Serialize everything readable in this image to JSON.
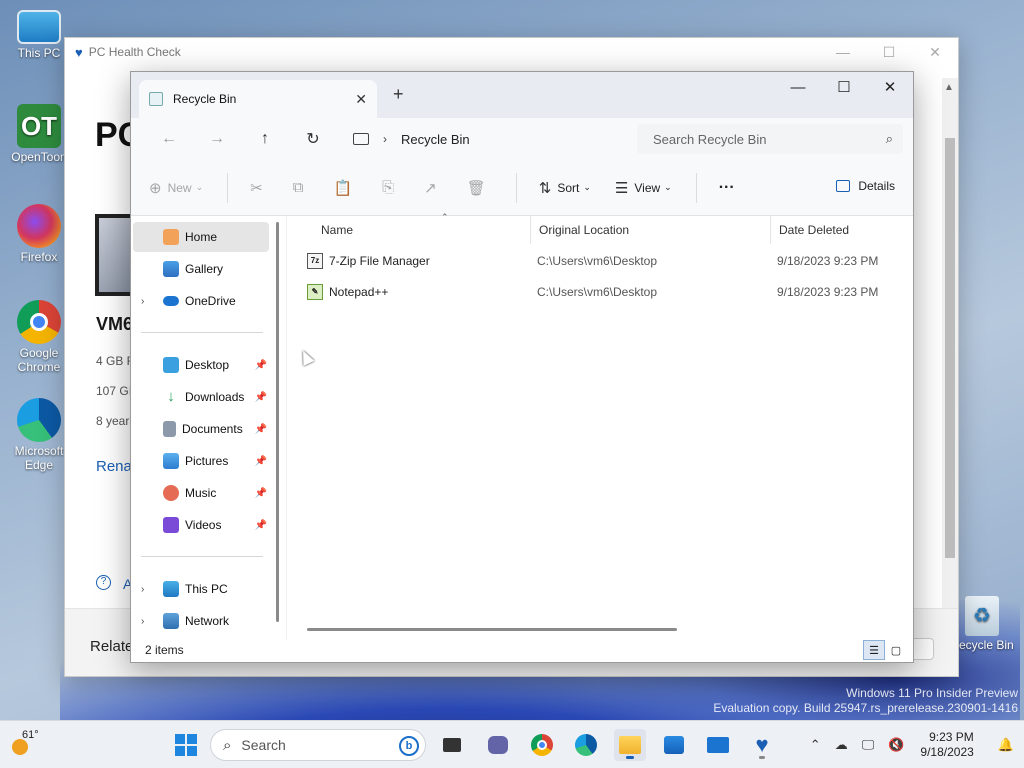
{
  "desktop": {
    "icons": [
      {
        "label": "This PC"
      },
      {
        "label": "OpenToon"
      },
      {
        "label": "Firefox"
      },
      {
        "label": "Google Chrome"
      },
      {
        "label": "Microsoft Edge"
      },
      {
        "label": "Recycle Bin"
      }
    ],
    "watermark_line1": "Windows 11 Pro Insider Preview",
    "watermark_line2": "Evaluation copy. Build 25947.rs_prerelease.230901-1416"
  },
  "health_window": {
    "title": "PC Health Check",
    "heading": "PC",
    "device_name": "VM6",
    "spec_ram": "4 GB R",
    "spec_storage": "107 GI",
    "spec_age": "8 years",
    "rename_link": "Rena",
    "help_text": "A",
    "related": "Relate"
  },
  "explorer": {
    "tab_title": "Recycle Bin",
    "new_tab": "+",
    "address": "Recycle Bin",
    "search_placeholder": "Search Recycle Bin",
    "toolbar": {
      "new_label": "New",
      "sort_label": "Sort",
      "view_label": "View",
      "more_label": "···",
      "details_label": "Details"
    },
    "nav": {
      "home": "Home",
      "gallery": "Gallery",
      "onedrive": "OneDrive",
      "desktop": "Desktop",
      "downloads": "Downloads",
      "documents": "Documents",
      "pictures": "Pictures",
      "music": "Music",
      "videos": "Videos",
      "thispc": "This PC",
      "network": "Network"
    },
    "columns": {
      "name": "Name",
      "location": "Original Location",
      "date": "Date Deleted"
    },
    "files": [
      {
        "name": "7-Zip File Manager",
        "location": "C:\\Users\\vm6\\Desktop",
        "date": "9/18/2023 9:23 PM",
        "icon": "7z"
      },
      {
        "name": "Notepad++",
        "location": "C:\\Users\\vm6\\Desktop",
        "date": "9/18/2023 9:23 PM",
        "icon": "np"
      }
    ],
    "status": "2 items"
  },
  "taskbar": {
    "temperature": "61°",
    "search_label": "Search",
    "time": "9:23 PM",
    "date": "9/18/2023"
  }
}
